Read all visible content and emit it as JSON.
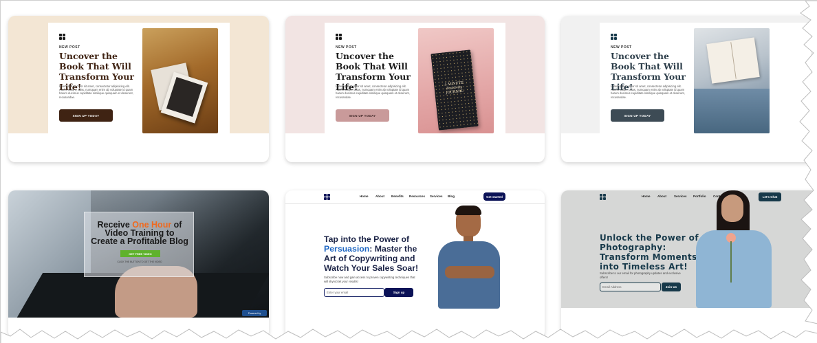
{
  "templates": [
    {
      "accent": "#3f2313",
      "eyebrow": "NEW POST",
      "headline": "Uncover the Book That Will Transform Your Life!",
      "body": "Lorem ipsum dolor sit amet, consectetur adipisicing elit. Autem dolore, alias, numquam enim ab voluptate id quam harum ducimus cupiditate similique quisquam et deserunt, recusandae.",
      "button": "SIGN UP TODAY"
    },
    {
      "accent": "#c99a9a",
      "eyebrow": "NEW POST",
      "headline": "Uncover the Book That Will Transform Your Life!",
      "body": "Lorem ipsum dolor sit amet, consectetur adipisicing elit. Autem dolore, alias, numquam enim ab voluptate id quam harum ducimus cupiditate similique quisquam et deserunt, recusandae.",
      "button": "SIGN UP TODAY",
      "book_title": "5 MINUTE Positivity JOURNAL"
    },
    {
      "accent": "#3d4b55",
      "eyebrow": "NEW POST",
      "headline": "Uncover the Book That Will Transform Your Life!",
      "body": "Lorem ipsum dolor sit amet, consectetur adipisicing elit. Autem dolore, alias, numquam enim ab voluptate id quam harum ducimus cupiditate similique quisquam et deserunt, recusandae.",
      "button": "SIGN UP TODAY"
    }
  ],
  "video": {
    "line1_a": "Receive ",
    "line1_highlight": "One Hour",
    "line1_b": " of",
    "line2": "Video Training to",
    "line3": "Create a Profitable Blog",
    "button": "GET FREE VIDEO",
    "note": "CLICK THE BUTTON TO GET THE VIDEO",
    "badge": "Powered by"
  },
  "persuasion": {
    "nav": [
      "Home",
      "About",
      "Benefits",
      "Resources",
      "Services",
      "Blog"
    ],
    "cta": "Get started",
    "h_a": "Tap into the Power of",
    "h_highlight": "Persuasion",
    "h_b": ": Master the",
    "h_c": "Art of Copywriting and",
    "h_d": "Watch Your Sales Soar!",
    "sub": "Subscribe now and gain access to proven copywriting techniques that will skyrocket your results!",
    "email_placeholder": "Enter your email",
    "signup": "Sign up",
    "accent": "#0b1257"
  },
  "photography": {
    "nav": [
      "Home",
      "About",
      "Services",
      "Portfolio",
      "Contact"
    ],
    "cta": "Let's Chat",
    "h1": "Unlock the Power of",
    "h2": "Photography:",
    "h3": "Transform Moments",
    "h4": "into Timeless Art!",
    "sub": "Subscribe to our email for photography updates and exclusive offers!",
    "email_placeholder": "Email Address",
    "join": "Join Us",
    "accent": "#17394a"
  }
}
